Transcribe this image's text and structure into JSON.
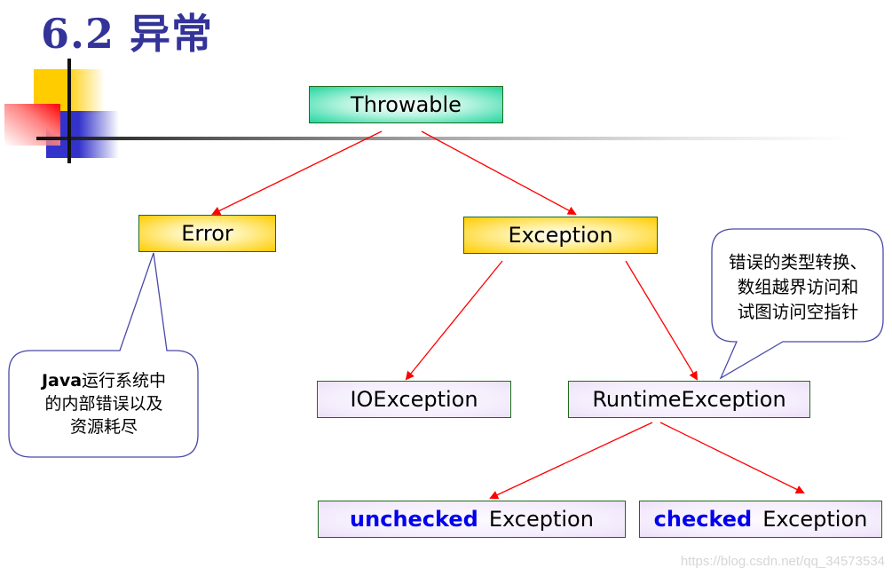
{
  "slide": {
    "title": "6.2 异常"
  },
  "diagram": {
    "nodes": {
      "throwable": "Throwable",
      "error": "Error",
      "exception": "Exception",
      "ioexception": "IOException",
      "runtimeexception": "RuntimeException",
      "unchecked": {
        "keyword": "unchecked",
        "label": "Exception"
      },
      "checked": {
        "keyword": "checked",
        "label": "Exception"
      }
    },
    "edges": [
      {
        "from": "Throwable",
        "to": "Error"
      },
      {
        "from": "Throwable",
        "to": "Exception"
      },
      {
        "from": "Exception",
        "to": "IOException"
      },
      {
        "from": "Exception",
        "to": "RuntimeException"
      },
      {
        "from": "RuntimeException",
        "to": "unchecked Exception"
      },
      {
        "from": "RuntimeException",
        "to": "checked Exception"
      }
    ],
    "callouts": {
      "error_note": {
        "bold": "Java",
        "lines": [
          "运行系统中",
          "的内部错误以及",
          "资源耗尽"
        ]
      },
      "runtime_note": {
        "lines": [
          "错误的类型转换、",
          "数组越界访问和",
          "试图访问空指针"
        ]
      }
    },
    "colors": {
      "arrow": "#ff0000",
      "callout_border": "#4a4aa8",
      "node_border": "#1e6b1e",
      "title": "#333399",
      "keyword": "#0000ee"
    }
  },
  "watermark": "https://blog.csdn.net/qq_34573534"
}
